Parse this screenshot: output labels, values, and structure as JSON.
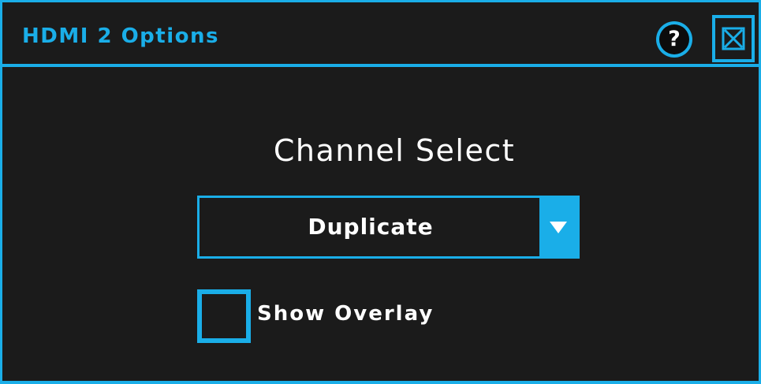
{
  "dialog": {
    "title": "HDMI 2 Options",
    "help_icon": "question-mark-circle-icon",
    "help_symbol": "?",
    "close_icon": "close-box-icon"
  },
  "channel_select": {
    "heading": "Channel Select",
    "selected_value": "Duplicate",
    "dropdown_icon": "triangle-down-icon"
  },
  "overlay": {
    "label": "Show Overlay",
    "checked": false
  },
  "colors": {
    "accent": "#1aaee8",
    "background": "#1b1b1b",
    "text": "#ffffff"
  }
}
